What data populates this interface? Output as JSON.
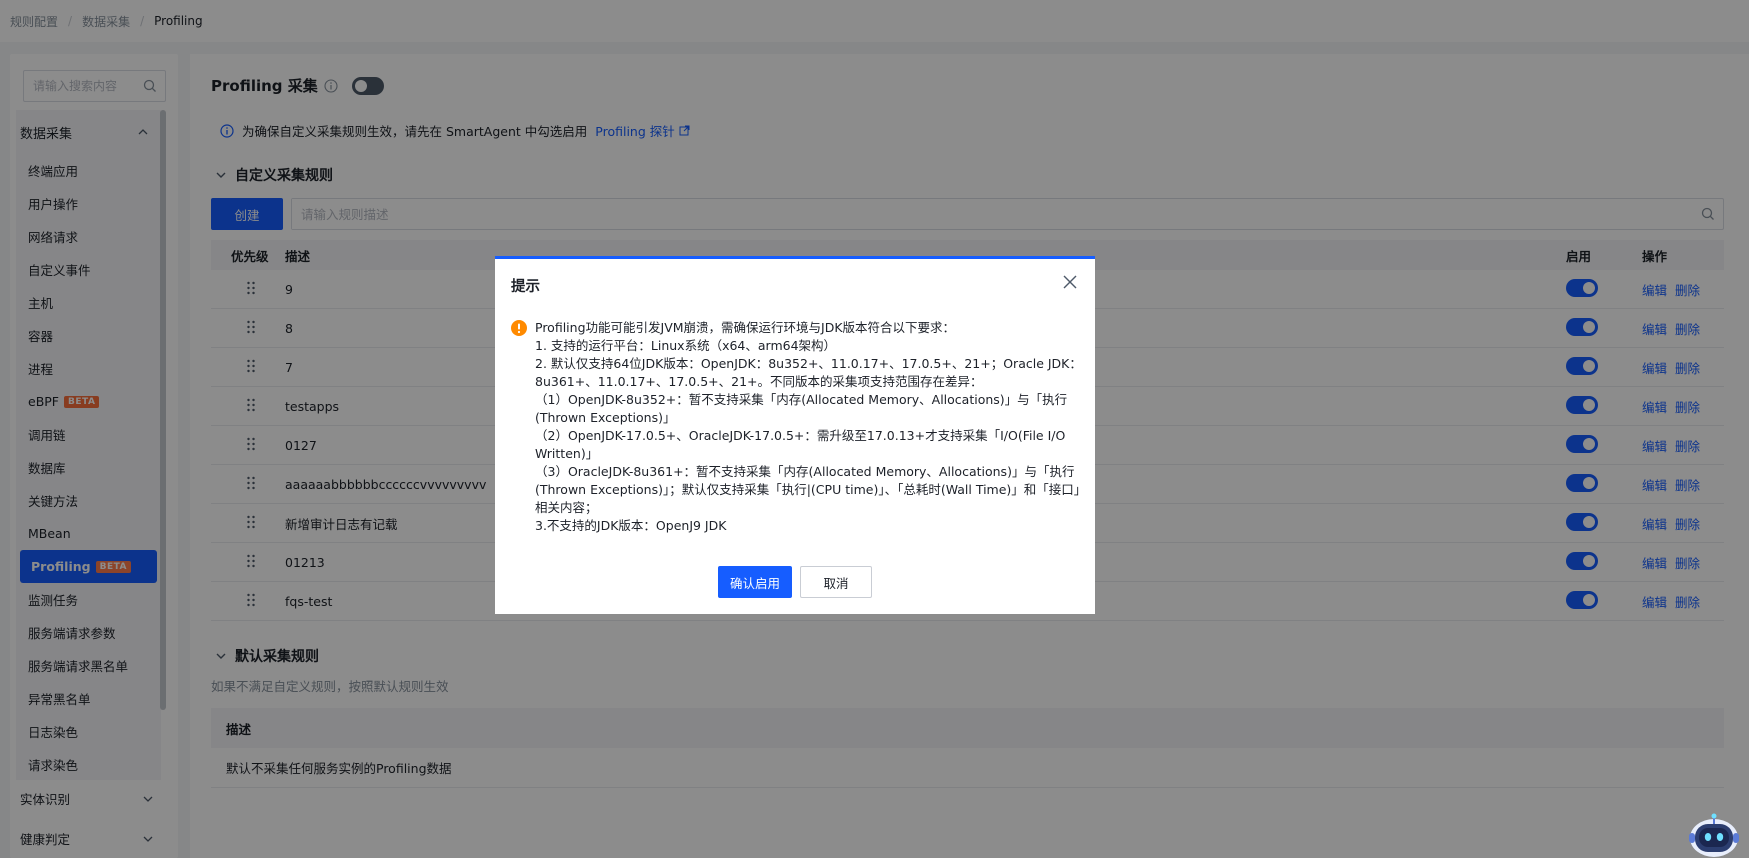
{
  "breadcrumb": [
    "规则配置",
    "数据采集",
    "Profiling"
  ],
  "sidebar": {
    "search_placeholder": "请输入搜索内容",
    "group_title": "数据采集",
    "items": [
      {
        "label": "终端应用"
      },
      {
        "label": "用户操作"
      },
      {
        "label": "网络请求"
      },
      {
        "label": "自定义事件"
      },
      {
        "label": "主机"
      },
      {
        "label": "容器"
      },
      {
        "label": "进程"
      },
      {
        "label": "eBPF",
        "badge": "BETA"
      },
      {
        "label": "调用链"
      },
      {
        "label": "数据库"
      },
      {
        "label": "关键方法"
      },
      {
        "label": "MBean"
      },
      {
        "label": "Profiling",
        "badge": "BETA",
        "active": true
      },
      {
        "label": "监测任务"
      },
      {
        "label": "服务端请求参数"
      },
      {
        "label": "服务端请求黑名单"
      },
      {
        "label": "异常黑名单"
      },
      {
        "label": "日志染色"
      },
      {
        "label": "请求染色"
      }
    ],
    "bottom_groups": [
      "实体识别",
      "健康判定"
    ]
  },
  "main": {
    "title": "Profiling 采集",
    "info_text": "为确保自定义采集规则生效，请先在 SmartAgent 中勾选启用",
    "info_link": "Profiling 探针",
    "custom_section": "自定义采集规则",
    "create_label": "创建",
    "rule_search_placeholder": "请输入规则描述",
    "columns": {
      "priority": "优先级",
      "desc": "描述",
      "enabled": "启用",
      "ops": "操作"
    },
    "rows": [
      {
        "desc": "9"
      },
      {
        "desc": "8"
      },
      {
        "desc": "7"
      },
      {
        "desc": "testapps"
      },
      {
        "desc": "0127"
      },
      {
        "desc": "aaaaaabbbbbbccccccvvvvvvvvv"
      },
      {
        "desc": "新增审计日志有记载"
      },
      {
        "desc": "01213"
      },
      {
        "desc": "fqs-test"
      }
    ],
    "edit_label": "编辑",
    "delete_label": "删除",
    "default_section": "默认采集规则",
    "default_desc": "如果不满足自定义规则，按照默认规则生效",
    "default_col": "描述",
    "default_row": "默认不采集任何服务实例的Profiling数据"
  },
  "modal": {
    "title": "提示",
    "lines": [
      "Profiling功能可能引发JVM崩溃，需确保运行环境与JDK版本符合以下要求：",
      "1. 支持的运行平台：Linux系统（x64、arm64架构）",
      "2. 默认仅支持64位JDK版本：OpenJDK：8u352+、11.0.17+、17.0.5+、21+；Oracle JDK：8u361+、11.0.17+、17.0.5+、21+。不同版本的采集项支持范围存在差异：",
      "（1）OpenJDK-8u352+：暂不支持采集「内存(Allocated Memory、Allocations)」与「执行(Thrown Exceptions)」",
      "（2）OpenJDK-17.0.5+、OracleJDK-17.0.5+：需升级至17.0.13+才支持采集「I/O(File I/O Written)」",
      "（3）OracleJDK-8u361+：暂不支持采集「内存(Allocated Memory、Allocations)」与「执行(Thrown Exceptions)」；默认仅支持采集「执行|(CPU time)」、「总耗时(Wall Time)」和「接口」相关内容；",
      "3.不支持的JDK版本：OpenJ9 JDK"
    ],
    "confirm_label": "确认启用",
    "cancel_label": "取消"
  },
  "colors": {
    "primary": "#165dff",
    "badge": "#f76e3b",
    "warning": "#ff8a00"
  }
}
